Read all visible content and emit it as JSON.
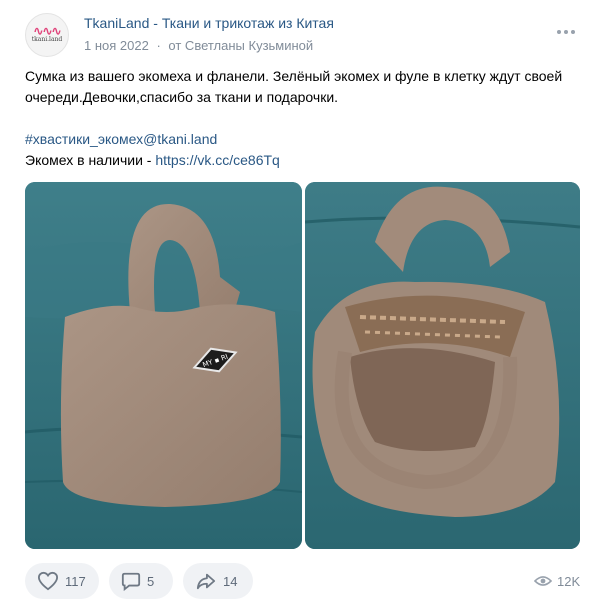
{
  "post": {
    "group_name": "TkaniLand - Ткани и трикотаж из Китая",
    "avatar_text": "tkani.land",
    "date": "1 ноя 2022",
    "separator": "·",
    "author": "от Светланы Кузьминой",
    "more_icon": "more-dots-icon",
    "text_lines": [
      "Сумка из вашего экомеха и фланели. Зелёный экомех и фуле в клетку ждут своей",
      "очереди.Девочки,спасибо за ткани и подарочки."
    ],
    "hashtag": "#хвастики_экомех@tkani.land",
    "link_prefix": "Экомех в наличии - ",
    "link_url": "https://vk.cc/ce86Tq",
    "photos": [
      {
        "name": "photo-bag-front",
        "patch_text": "MY ▪ RI"
      },
      {
        "name": "photo-bag-open"
      }
    ]
  },
  "actions": {
    "likes": "117",
    "comments": "5",
    "shares": "14",
    "views": "12K"
  },
  "colors": {
    "link": "#2a5885",
    "meta": "#818c99",
    "button_bg": "#f0f2f5",
    "sofa": "#2f6e79",
    "bag": "#a08a7a"
  }
}
